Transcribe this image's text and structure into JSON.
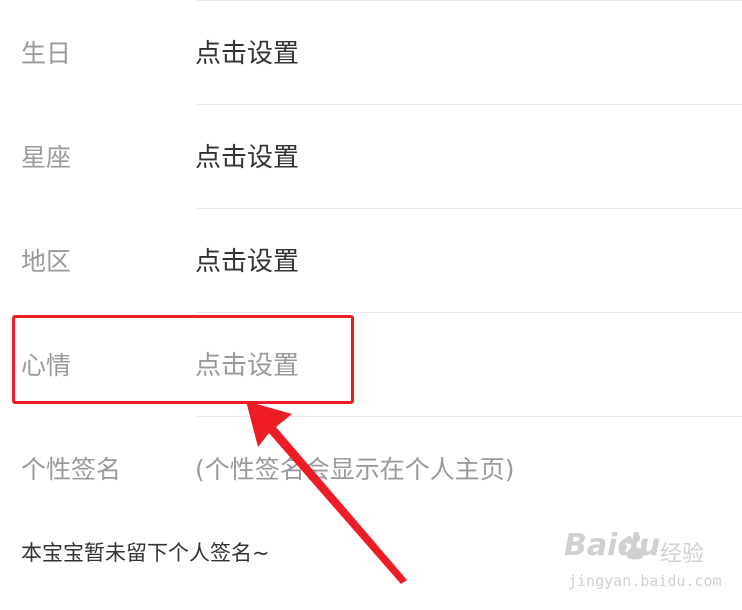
{
  "profile": {
    "rows": [
      {
        "label": "生日",
        "value": "点击设置"
      },
      {
        "label": "星座",
        "value": "点击设置"
      },
      {
        "label": "地区",
        "value": "点击设置"
      },
      {
        "label": "心情",
        "value": "点击设置"
      },
      {
        "label": "个性签名",
        "value": "(个性签名会显示在个人主页)"
      }
    ],
    "signature_text": "本宝宝暂未留下个人签名~"
  },
  "annotation": {
    "highlight_color": "#ee1c25",
    "highlighted_row": "心情"
  },
  "watermark": {
    "brand": "Baidu",
    "sub": "经验",
    "url": "jingyan.baidu.com"
  },
  "colors": {
    "label": "#9a9a9a",
    "value": "#333333",
    "divider": "#e9e9e9"
  }
}
